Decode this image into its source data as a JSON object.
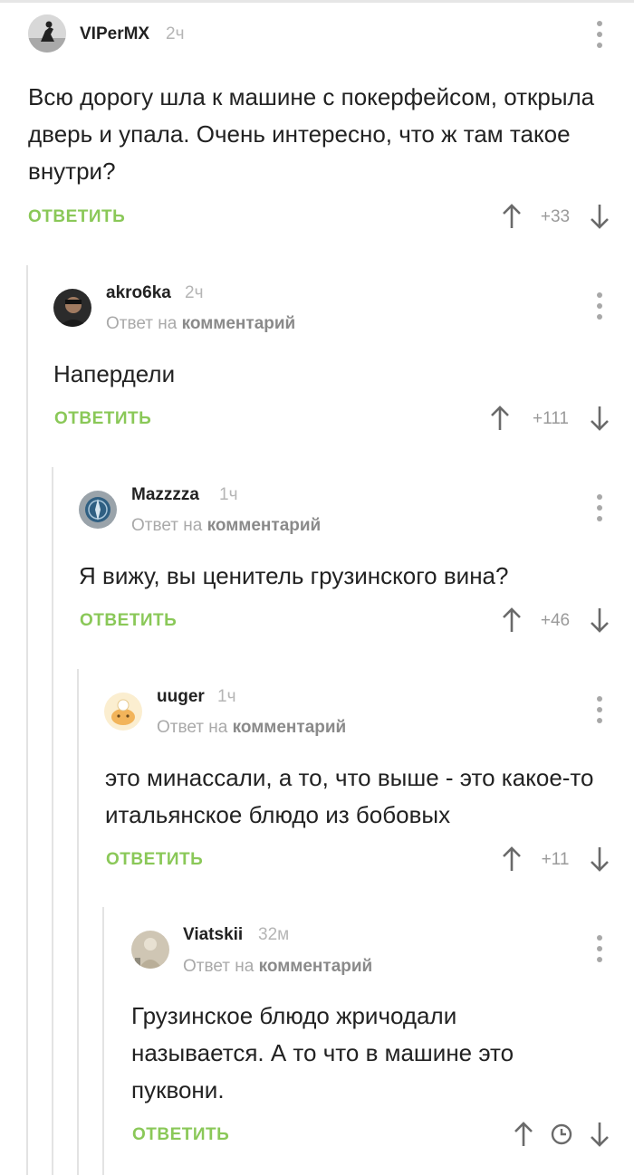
{
  "common": {
    "reply_label": "ОТВЕТИТЬ",
    "reply_to_prefix": "Ответ на",
    "reply_to_link": "комментарий"
  },
  "comments": [
    {
      "user": "VIPerMX",
      "time": "2ч",
      "text": "Всю дорогу шла к машине с покерфейсом, открыла дверь и упала. Очень интересно, что ж там такое внутри?",
      "score": "+33",
      "avatar": "avatar-silhouette-icon"
    },
    {
      "user": "akro6ka",
      "time": "2ч",
      "text": "Напердели",
      "score": "+111",
      "avatar": "avatar-photo-icon"
    },
    {
      "user": "Mazzzza",
      "time": "1ч",
      "text": "Я вижу, вы ценитель грузинского вина?",
      "score": "+46",
      "avatar": "avatar-compass-icon"
    },
    {
      "user": "uuger",
      "time": "1ч",
      "text": "это минассали, а то, что выше - это какое-то итальянское блюдо из бобовых",
      "score": "+11",
      "avatar": "avatar-cartoon-icon"
    },
    {
      "user": "Viatskii",
      "time": "32м",
      "text": "Грузинское блюдо жричодали называется. А то что в машине это пуквони.",
      "score_hidden": "clock-icon",
      "avatar": "avatar-statue-icon"
    }
  ],
  "colors": {
    "reply": "#8ac858",
    "thread_line": "#e3e3e3",
    "muted": "#a9a9a9"
  }
}
